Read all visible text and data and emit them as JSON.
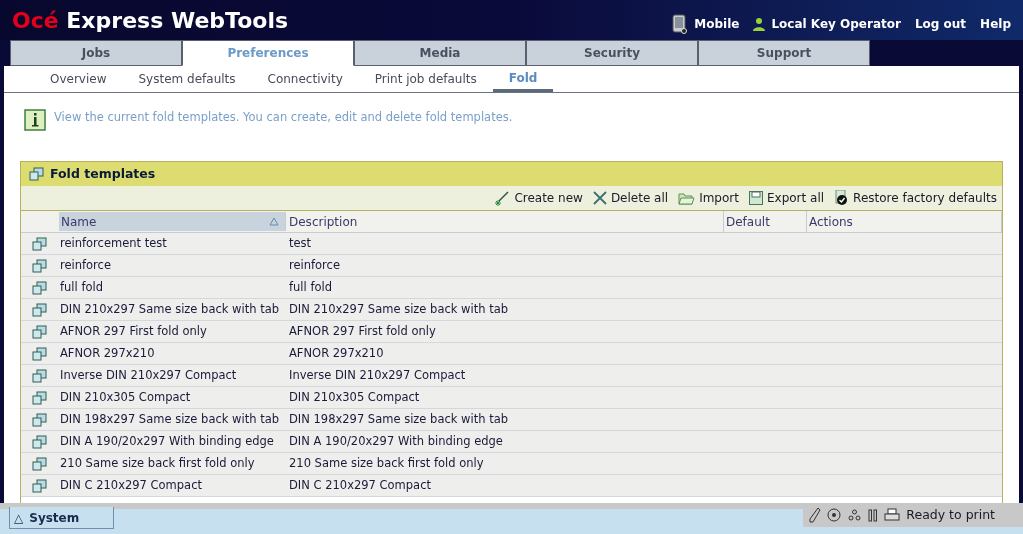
{
  "app": {
    "brand": "Océ",
    "title": "Express WebTools"
  },
  "top_links": [
    {
      "kind": "mobile",
      "label": "Mobile"
    },
    {
      "kind": "user",
      "label": "Local Key Operator"
    },
    {
      "kind": "plain",
      "label": "Log out"
    },
    {
      "kind": "plain",
      "label": "Help"
    }
  ],
  "tabs": [
    {
      "label": "Jobs",
      "selected": false
    },
    {
      "label": "Preferences",
      "selected": true
    },
    {
      "label": "Media",
      "selected": false
    },
    {
      "label": "Security",
      "selected": false
    },
    {
      "label": "Support",
      "selected": false
    }
  ],
  "subtabs": [
    {
      "label": "Overview",
      "selected": false
    },
    {
      "label": "System defaults",
      "selected": false
    },
    {
      "label": "Connectivity",
      "selected": false
    },
    {
      "label": "Print job defaults",
      "selected": false
    },
    {
      "label": "Fold",
      "selected": true
    }
  ],
  "info": "View the current fold templates. You can create, edit and delete fold templates.",
  "panel": {
    "title": "Fold templates",
    "actions": [
      {
        "kind": "create",
        "label": "Create new"
      },
      {
        "kind": "delete",
        "label": "Delete all"
      },
      {
        "kind": "import",
        "label": "Import"
      },
      {
        "kind": "export",
        "label": "Export all"
      },
      {
        "kind": "restore",
        "label": "Restore factory defaults"
      }
    ],
    "columns": [
      {
        "label": "Name",
        "sorted": true
      },
      {
        "label": "Description",
        "sorted": false
      },
      {
        "label": "Default",
        "sorted": false
      },
      {
        "label": "Actions",
        "sorted": false
      }
    ],
    "rows": [
      {
        "name": "reinforcement test",
        "description": "test"
      },
      {
        "name": "reinforce",
        "description": "reinforce"
      },
      {
        "name": "full fold",
        "description": "full fold"
      },
      {
        "name": "DIN 210x297 Same size back with tab",
        "description": "DIN 210x297 Same size back with tab"
      },
      {
        "name": "AFNOR 297 First fold only",
        "description": "AFNOR 297 First fold only"
      },
      {
        "name": "AFNOR 297x210",
        "description": "AFNOR 297x210"
      },
      {
        "name": "Inverse DIN 210x297 Compact",
        "description": "Inverse DIN 210x297 Compact"
      },
      {
        "name": "DIN 210x305 Compact",
        "description": "DIN 210x305 Compact"
      },
      {
        "name": "DIN 198x297 Same size back with tab",
        "description": "DIN 198x297 Same size back with tab"
      },
      {
        "name": "DIN A 190/20x297 With binding edge",
        "description": "DIN A 190/20x297 With binding edge"
      },
      {
        "name": "210 Same size back first fold only",
        "description": "210 Same size back first fold only"
      },
      {
        "name": "DIN C 210x297 Compact",
        "description": "DIN C 210x297 Compact"
      }
    ]
  },
  "status_bar": {
    "tab": {
      "icon": "△",
      "label": "System"
    },
    "status": "Ready to print"
  }
}
